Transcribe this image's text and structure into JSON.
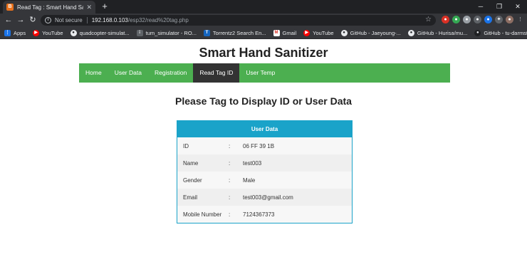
{
  "browser": {
    "tab": {
      "title": "Read Tag : Smart Hand Sanitizer",
      "close": "✕",
      "favicon": "B"
    },
    "new_tab": "+",
    "window_controls": {
      "minimize": "─",
      "maximize": "❐",
      "close": "✕"
    },
    "nav": {
      "back": "←",
      "forward": "→",
      "reload": "↻"
    },
    "address": {
      "security": "Not secure",
      "host": "192.168.0.103",
      "path": "/esp32/read%20tag.php"
    },
    "bookmarks": [
      {
        "label": "Apps",
        "icon": "apps-grid-icon"
      },
      {
        "label": "YouTube",
        "icon": "youtube-icon"
      },
      {
        "label": "quadcopter-simulat...",
        "icon": "github-icon"
      },
      {
        "label": "tum_simulator - RO...",
        "icon": "ros-icon"
      },
      {
        "label": "Torrentz2 Search En...",
        "icon": "torrentz-icon"
      },
      {
        "label": "Gmail",
        "icon": "gmail-icon"
      },
      {
        "label": "YouTube",
        "icon": "youtube-icon"
      },
      {
        "label": "GitHub - Jaeyoung-...",
        "icon": "github-icon"
      },
      {
        "label": "GitHub - Hurisa/mu...",
        "icon": "github-icon"
      },
      {
        "label": "GitHub - tu-darmst...",
        "icon": "github-icon"
      }
    ]
  },
  "site": {
    "title": "Smart Hand Sanitizer",
    "nav": [
      {
        "label": "Home",
        "active": false
      },
      {
        "label": "User Data",
        "active": false
      },
      {
        "label": "Registration",
        "active": false
      },
      {
        "label": "Read Tag ID",
        "active": true
      },
      {
        "label": "User Temp",
        "active": false
      }
    ],
    "heading": "Please Tag to Display ID or User Data",
    "table": {
      "header": "User Data",
      "rows": [
        {
          "label": "ID",
          "colon": ":",
          "value": "06 FF 39 1B"
        },
        {
          "label": "Name",
          "colon": ":",
          "value": "test003"
        },
        {
          "label": "Gender",
          "colon": ":",
          "value": "Male"
        },
        {
          "label": "Email",
          "colon": ":",
          "value": "test003@gmail.com"
        },
        {
          "label": "Mobile Number",
          "colon": ":",
          "value": "7124367373"
        }
      ]
    }
  },
  "colors": {
    "nav_green": "#4caf50",
    "nav_active": "#333333",
    "table_header": "#1aa3c9"
  }
}
